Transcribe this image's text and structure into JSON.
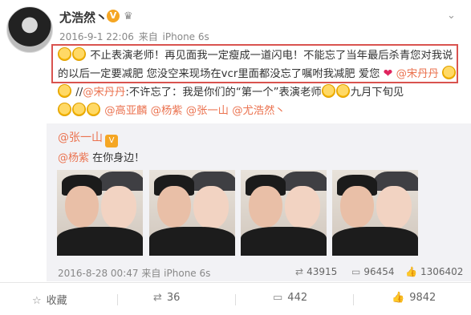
{
  "post": {
    "author": "尤浩然丶",
    "verified_badge": "V",
    "meta_date": "2016-9-1 22:06",
    "meta_source_prefix": "来自",
    "meta_device": "iPhone 6s",
    "text_part1": "不止表演老师！再见面我一定瘦成一道闪电！不能忘了当年最后杀青您对我说的以后一定要减肥 您没空来现场在vcr里面都没忘了嘱咐我减肥 爱您",
    "text_mention_a": "@宋丹丹",
    "text_part2": "//",
    "text_mention_b": "@宋丹丹",
    "text_part3": ":不许忘了：我是你们的“第一个”表演老师",
    "text_part4": "九月下旬见",
    "text_mentions": [
      "@高亚麟",
      "@杨紫",
      "@张一山",
      "@尤浩然丶"
    ]
  },
  "repost": {
    "author": "@张一山",
    "badge": "V",
    "mention": "@杨紫",
    "text": " 在你身边！",
    "date": "2016-8-28 00:47",
    "source_prefix": "来自",
    "device": "iPhone 6s",
    "stats": {
      "reposts": "43915",
      "comments": "96454",
      "likes": "1306402"
    }
  },
  "actions": {
    "favorite": "收藏",
    "repost": "36",
    "comment": "442",
    "like": "9842"
  },
  "colors": {
    "link": "#eb7350",
    "highlight_border": "#d9534f",
    "repost_bg": "#f2f2f5"
  }
}
